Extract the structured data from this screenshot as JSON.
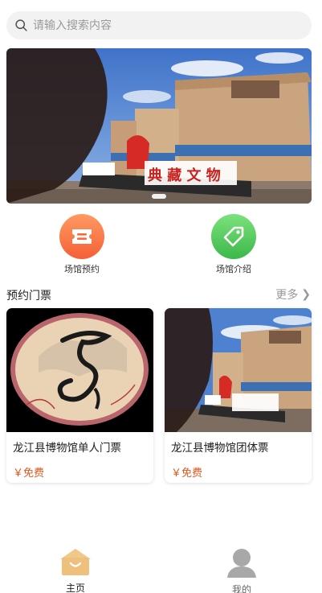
{
  "search": {
    "placeholder": "请输入搜索内容"
  },
  "banner": {
    "sign_text": "典 藏 文 物",
    "dot_count": 1
  },
  "quick_links": [
    {
      "label": "场馆预约",
      "icon": "ticket-icon",
      "color": "#f76a3c"
    },
    {
      "label": "场馆介绍",
      "icon": "tag-icon",
      "color": "#4cc656"
    }
  ],
  "tickets_section": {
    "title": "预约门票",
    "more_label": "更多"
  },
  "tickets": [
    {
      "name": "龙江县博物馆单人门票",
      "price": "￥免费"
    },
    {
      "name": "龙江县博物馆团体票",
      "price": "￥免费"
    }
  ],
  "tabbar": [
    {
      "label": "主页",
      "icon": "home-icon",
      "active": true
    },
    {
      "label": "我的",
      "icon": "user-icon",
      "active": false
    }
  ],
  "colors": {
    "accent_price": "#e2561c",
    "home_icon": "#eec07c"
  }
}
